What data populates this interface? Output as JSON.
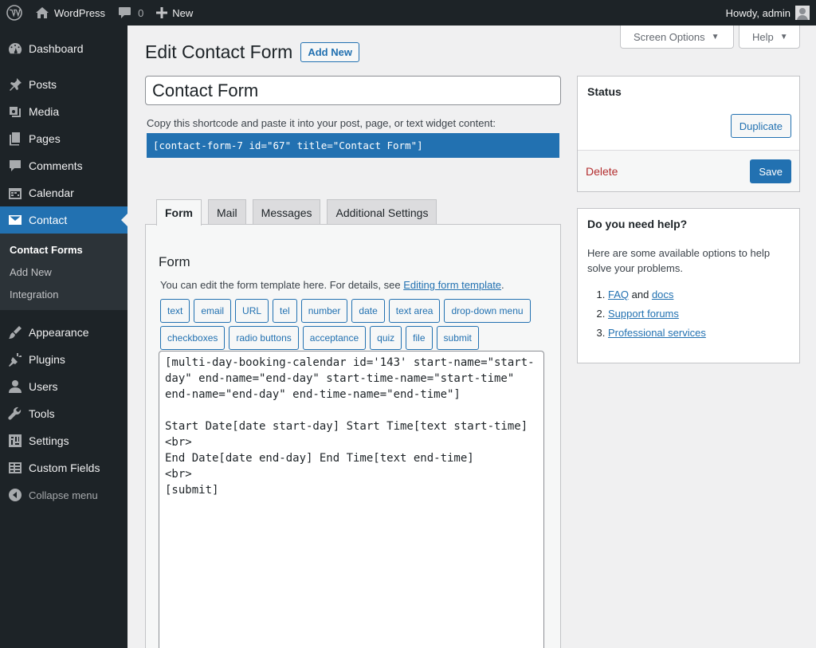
{
  "adminbar": {
    "site_name": "WordPress",
    "comments_count": "0",
    "new_label": "New",
    "howdy": "Howdy, admin"
  },
  "sidebar": {
    "items": [
      {
        "label": "Dashboard",
        "icon": "dashboard-icon"
      },
      {
        "label": "Posts",
        "icon": "pushpin-icon"
      },
      {
        "label": "Media",
        "icon": "media-icon"
      },
      {
        "label": "Pages",
        "icon": "pages-icon"
      },
      {
        "label": "Comments",
        "icon": "comments-icon"
      },
      {
        "label": "Calendar",
        "icon": "calendar-icon"
      },
      {
        "label": "Contact",
        "icon": "mail-icon"
      },
      {
        "label": "Appearance",
        "icon": "paintbrush-icon"
      },
      {
        "label": "Plugins",
        "icon": "plugin-icon"
      },
      {
        "label": "Users",
        "icon": "users-icon"
      },
      {
        "label": "Tools",
        "icon": "wrench-icon"
      },
      {
        "label": "Settings",
        "icon": "settings-icon"
      },
      {
        "label": "Custom Fields",
        "icon": "table-icon"
      }
    ],
    "submenu": [
      "Contact Forms",
      "Add New",
      "Integration"
    ],
    "collapse_label": "Collapse menu"
  },
  "screen_options": {
    "screen_label": "Screen Options",
    "help_label": "Help"
  },
  "page": {
    "title": "Edit Contact Form",
    "add_new": "Add New",
    "form_title_value": "Contact Form",
    "shortcode_label": "Copy this shortcode and paste it into your post, page, or text widget content:",
    "shortcode": "[contact-form-7 id=\"67\" title=\"Contact Form\"]"
  },
  "tabs": [
    "Form",
    "Mail",
    "Messages",
    "Additional Settings"
  ],
  "form_panel": {
    "heading": "Form",
    "desc_prefix": "You can edit the form template here. For details, see ",
    "desc_link": "Editing form template",
    "desc_suffix": ".",
    "tags_row1": [
      "text",
      "email",
      "URL",
      "tel",
      "number",
      "date",
      "text area",
      "drop-down menu"
    ],
    "tags_row2": [
      "checkboxes",
      "radio buttons",
      "acceptance",
      "quiz",
      "file",
      "submit"
    ],
    "template": "[multi-day-booking-calendar id='143' start-name=\"start-\nday\" end-name=\"end-day\" start-time-name=\"start-time\"\nend-name=\"end-day\" end-time-name=\"end-time\"]\n\nStart Date[date start-day] Start Time[text start-time]\n<br>\nEnd Date[date end-day] End Time[text end-time]\n<br>\n[submit]"
  },
  "status_box": {
    "title": "Status",
    "duplicate": "Duplicate",
    "delete": "Delete",
    "save": "Save"
  },
  "help_box": {
    "title": "Do you need help?",
    "intro": "Here are some available options to help solve your problems.",
    "item1_link_a": "FAQ",
    "item1_and": " and ",
    "item1_link_b": "docs",
    "item2": "Support forums",
    "item3": "Professional services"
  },
  "colors": {
    "accent": "#2271b1",
    "admin_bg": "#1d2327",
    "delete": "#b32d2e"
  }
}
